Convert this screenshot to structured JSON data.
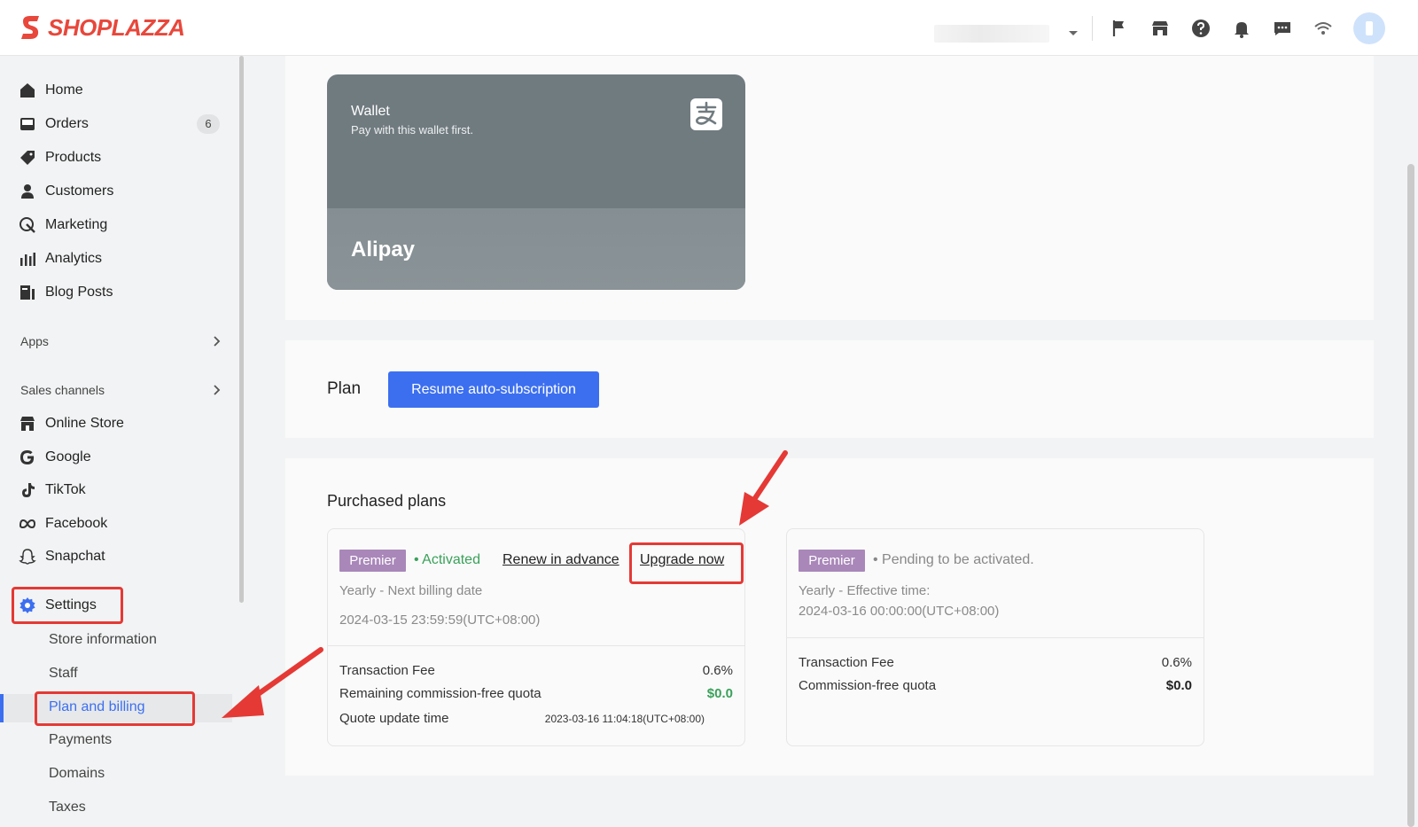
{
  "header": {
    "brand": "SHOPLAZZA",
    "icons": [
      "flag-icon",
      "store-icon",
      "help-icon",
      "bell-icon",
      "chat-icon",
      "wifi-icon"
    ]
  },
  "sidebar": {
    "items": [
      {
        "label": "Home",
        "icon": "home-icon"
      },
      {
        "label": "Orders",
        "icon": "orders-icon",
        "badge": "6"
      },
      {
        "label": "Products",
        "icon": "tag-icon"
      },
      {
        "label": "Customers",
        "icon": "person-icon"
      },
      {
        "label": "Marketing",
        "icon": "marketing-icon"
      },
      {
        "label": "Analytics",
        "icon": "bar-chart-icon"
      },
      {
        "label": "Blog Posts",
        "icon": "blog-icon"
      }
    ],
    "apps_label": "Apps",
    "sales_channels_label": "Sales channels",
    "channels": [
      {
        "label": "Online Store",
        "icon": "store-icon"
      },
      {
        "label": "Google",
        "icon": "google-icon"
      },
      {
        "label": "TikTok",
        "icon": "tiktok-icon"
      },
      {
        "label": "Facebook",
        "icon": "meta-icon"
      },
      {
        "label": "Snapchat",
        "icon": "snapchat-icon"
      }
    ],
    "settings_label": "Settings",
    "settings_sub": [
      "Store information",
      "Staff",
      "Plan and billing",
      "Payments",
      "Domains",
      "Taxes"
    ]
  },
  "wallet": {
    "title": "Wallet",
    "subtitle": "Pay with this wallet first.",
    "name": "Alipay",
    "icon": "alipay-icon"
  },
  "plan": {
    "label": "Plan",
    "resume_button": "Resume auto-subscription"
  },
  "purchased": {
    "title": "Purchased plans",
    "current": {
      "tag": "Premier",
      "status": "• Activated",
      "renew_link": "Renew in advance",
      "upgrade_link": "Upgrade now",
      "cycle": "Yearly - Next billing date",
      "date": "2024-03-15 23:59:59(UTC+08:00)",
      "fee_label": "Transaction Fee",
      "fee_value": "0.6%",
      "quota_label": "Remaining commission-free quota",
      "quota_value": "$0.0",
      "update_label": "Quote update time",
      "update_value": "2023-03-16 11:04:18(UTC+08:00)"
    },
    "pending": {
      "tag": "Premier",
      "status": "• Pending to be activated.",
      "cycle": "Yearly - Effective time:",
      "date": "2024-03-16 00:00:00(UTC+08:00)",
      "fee_label": "Transaction Fee",
      "fee_value": "0.6%",
      "quota_label": "Commission-free quota",
      "quota_value": "$0.0"
    }
  },
  "colors": {
    "accent": "#3c6ff0",
    "tag": "#a987b9",
    "success": "#3aa15a",
    "highlight": "#e53935",
    "brand": "#e8473b"
  }
}
